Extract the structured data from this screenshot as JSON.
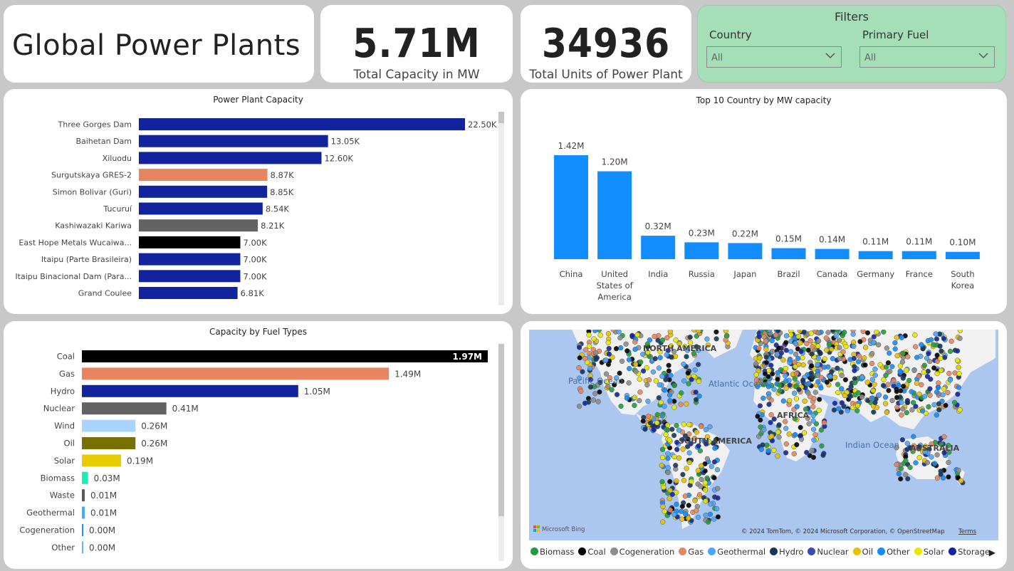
{
  "header": {
    "title": "Global Power Plants"
  },
  "kpis": {
    "capacity": {
      "value": "5.71M",
      "label": "Total Capacity in MW"
    },
    "units": {
      "value": "34936",
      "label": "Total Units of Power Plant"
    }
  },
  "filters": {
    "title": "Filters",
    "country": {
      "label": "Country",
      "value": "All"
    },
    "fuel": {
      "label": "Primary Fuel",
      "value": "All"
    }
  },
  "chart_data": [
    {
      "type": "bar",
      "orientation": "horizontal",
      "title": "Power Plant Capacity",
      "categories": [
        "Three Gorges Dam",
        "Baihetan Dam",
        "Xiluodu",
        "Surgutskaya GRES-2",
        "Simon Bolivar (Guri)",
        "Tucuruí",
        "Kashiwazaki Kariwa",
        "East Hope Metals Wucaiwa...",
        "Itaipu (Parte Brasileira)",
        "Itaipu Binacional Dam (Para...",
        "Grand Coulee"
      ],
      "values": [
        22500,
        13050,
        12600,
        8870,
        8850,
        8540,
        8210,
        7000,
        7000,
        7000,
        6810
      ],
      "value_labels": [
        "22.50K",
        "13.05K",
        "12.60K",
        "8.87K",
        "8.85K",
        "8.54K",
        "8.21K",
        "7.00K",
        "7.00K",
        "7.00K",
        "6.81K"
      ],
      "bar_colors": [
        "#12239e",
        "#12239e",
        "#12239e",
        "#e8845f",
        "#12239e",
        "#12239e",
        "#636363",
        "#000000",
        "#12239e",
        "#12239e",
        "#12239e"
      ]
    },
    {
      "type": "bar",
      "title": "Top 10 Country by MW capacity",
      "categories": [
        "China",
        "United States of America",
        "India",
        "Russia",
        "Japan",
        "Brazil",
        "Canada",
        "Germany",
        "France",
        "South Korea"
      ],
      "values": [
        1420000,
        1200000,
        320000,
        230000,
        220000,
        150000,
        140000,
        110000,
        110000,
        100000
      ],
      "value_labels": [
        "1.42M",
        "1.20M",
        "0.32M",
        "0.23M",
        "0.22M",
        "0.15M",
        "0.14M",
        "0.11M",
        "0.11M",
        "0.10M"
      ],
      "color": "#118dff"
    },
    {
      "type": "bar",
      "orientation": "horizontal",
      "title": "Capacity by Fuel Types",
      "categories": [
        "Coal",
        "Gas",
        "Hydro",
        "Nuclear",
        "Wind",
        "Oil",
        "Solar",
        "Biomass",
        "Waste",
        "Geothermal",
        "Cogeneration",
        "Other"
      ],
      "values": [
        1970000,
        1490000,
        1050000,
        410000,
        260000,
        260000,
        190000,
        30000,
        10000,
        10000,
        0,
        0
      ],
      "value_labels": [
        "1.97M",
        "1.49M",
        "1.05M",
        "0.41M",
        "0.26M",
        "0.26M",
        "0.19M",
        "0.03M",
        "0.01M",
        "0.01M",
        "0.00M",
        "0.00M"
      ],
      "bar_colors": [
        "#000000",
        "#e8845f",
        "#12239e",
        "#636363",
        "#a8d4ff",
        "#757000",
        "#e8cc00",
        "#1aedb8",
        "#5a5a5a",
        "#4aa6ff",
        "#1e90ff",
        "#63b4ff"
      ]
    }
  ],
  "map": {
    "labels": {
      "pacific": "Pacific Ocean",
      "atlantic": "Atlantic Ocean",
      "indian": "Indian Ocean",
      "north_america": "NORTH AMERICA",
      "south_america": "SOUTH AMERICA",
      "africa": "AFRICA",
      "australia": "AUSTRALIA"
    },
    "attribution": "© 2024 TomTom, © 2024 Microsoft Corporation, © OpenStreetMap",
    "terms": "Terms",
    "brand": "Microsoft Bing",
    "colors": {
      "water": "#abc6ef",
      "land": "#f1f1f1"
    }
  },
  "legend": [
    {
      "name": "Biomass",
      "color": "#1e9e3a"
    },
    {
      "name": "Coal",
      "color": "#000000"
    },
    {
      "name": "Cogeneration",
      "color": "#8c8c8c"
    },
    {
      "name": "Gas",
      "color": "#e8845f"
    },
    {
      "name": "Geothermal",
      "color": "#4aa6ff"
    },
    {
      "name": "Hydro",
      "color": "#12355b"
    },
    {
      "name": "Nuclear",
      "color": "#3c4bb0"
    },
    {
      "name": "Oil",
      "color": "#e8c000"
    },
    {
      "name": "Other",
      "color": "#118dff"
    },
    {
      "name": "Solar",
      "color": "#e8e800"
    },
    {
      "name": "Storage",
      "color": "#12239e"
    }
  ]
}
